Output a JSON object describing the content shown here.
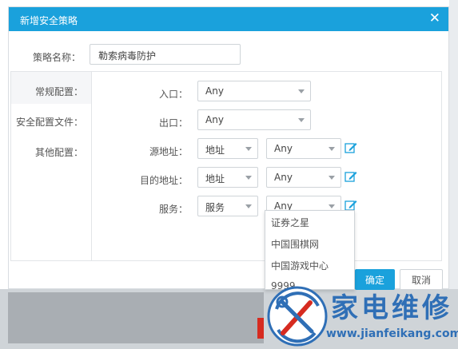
{
  "dialog": {
    "title": "新增安全策略",
    "close_glyph": "✕",
    "policy_name_label": "策略名称：",
    "policy_name_value": "勒索病毒防护"
  },
  "nav": {
    "items": [
      {
        "label": "常规配置："
      },
      {
        "label": "安全配置文件："
      },
      {
        "label": "其他配置："
      }
    ]
  },
  "form": {
    "entry_label": "入口：",
    "entry_value": "Any",
    "exit_label": "出口：",
    "exit_value": "Any",
    "source_label": "源地址：",
    "source_type": "地址",
    "source_value": "Any",
    "dest_label": "目的地址：",
    "dest_type": "地址",
    "dest_value": "Any",
    "service_label": "服务：",
    "service_type": "服务",
    "service_value": "Any"
  },
  "dropdown": {
    "options": [
      {
        "label": "证券之星"
      },
      {
        "label": "中国围棋网"
      },
      {
        "label": "中国游戏中心"
      },
      {
        "label": "9999"
      }
    ]
  },
  "buttons": {
    "confirm": "确定",
    "cancel": "取消"
  },
  "watermark": {
    "chinese": "家电维修",
    "url": "www.jianfeikang.com"
  },
  "colors": {
    "accent": "#1aa1dc",
    "watermark": "#2f6fb6"
  },
  "icons": {
    "close": "close-icon",
    "caret": "chevron-down-icon",
    "edit": "edit-icon"
  }
}
